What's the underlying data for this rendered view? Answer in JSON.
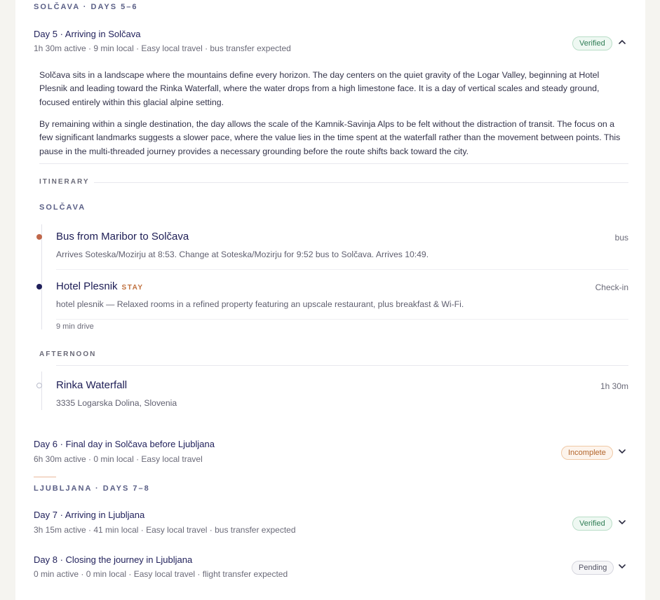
{
  "solcava_section": {
    "label": "SOLČAVA · DAYS 5–6"
  },
  "day5": {
    "title": "Day 5 · Arriving in Solčava",
    "meta": "1h 30m active · 9 min local · Easy local travel · bus transfer expected",
    "status": "Verified",
    "paragraphs": [
      "Solčava sits in a landscape where the mountains define every horizon. The day centers on the quiet gravity of the Logar Valley, beginning at Hotel Plesnik and leading toward the Rinka Waterfall, where the water drops from a high limestone face. It is a day of vertical scales and steady ground, focused entirely within this glacial alpine setting.",
      "By remaining within a single destination, the day allows the scale of the Kamnik-Savinja Alps to be felt without the distraction of transit. The focus on a few significant landmarks suggests a slower pace, where the value lies in the time spent at the waterfall rather than the movement between points. This pause in the multi-threaded journey provides a necessary grounding before the route shifts back toward the city."
    ],
    "itinerary_label": "ITINERARY",
    "location_label": "SOLČAVA",
    "items": [
      {
        "title": "Bus from Maribor to Solčava",
        "desc": "Arrives Soteska/Mozirju at 8:53. Change at Soteska/Mozirju for 9:52 bus to Solčava. Arrives 10:49.",
        "right": "bus"
      },
      {
        "title": "Hotel Plesnik",
        "tag": "STAY",
        "desc": "hotel plesnik — Relaxed rooms in a refined property featuring an upscale restaurant, plus breakfast & Wi-Fi.",
        "right": "Check-in"
      }
    ],
    "drive_note": "9 min drive",
    "afternoon_label": "AFTERNOON",
    "afternoon_item": {
      "title": "Rinka Waterfall",
      "desc": "3335 Logarska Dolina, Slovenia",
      "right": "1h 30m"
    }
  },
  "day6": {
    "title": "Day 6 · Final day in Solčava before Ljubljana",
    "meta": "6h 30m active · 0 min local · Easy local travel",
    "status": "Incomplete"
  },
  "ljubljana_section": {
    "label": "LJUBLJANA · DAYS 7–8"
  },
  "day7": {
    "title": "Day 7 · Arriving in Ljubljana",
    "meta": "3h 15m active · 41 min local · Easy local travel · bus transfer expected",
    "status": "Verified"
  },
  "day8": {
    "title": "Day 8 · Closing the journey in Ljubljana",
    "meta": "0 min active · 0 min local · Easy local travel · flight transfer expected",
    "status": "Pending"
  },
  "colors": {
    "bus_dot": "#c0674a",
    "stay_dot": "#1f1f5a",
    "activity_dot_border": "#b9bccb",
    "accent": "#e9b99a"
  },
  "icons": {
    "collapse": "chevron-up-icon",
    "expand": "chevron-down-icon"
  }
}
